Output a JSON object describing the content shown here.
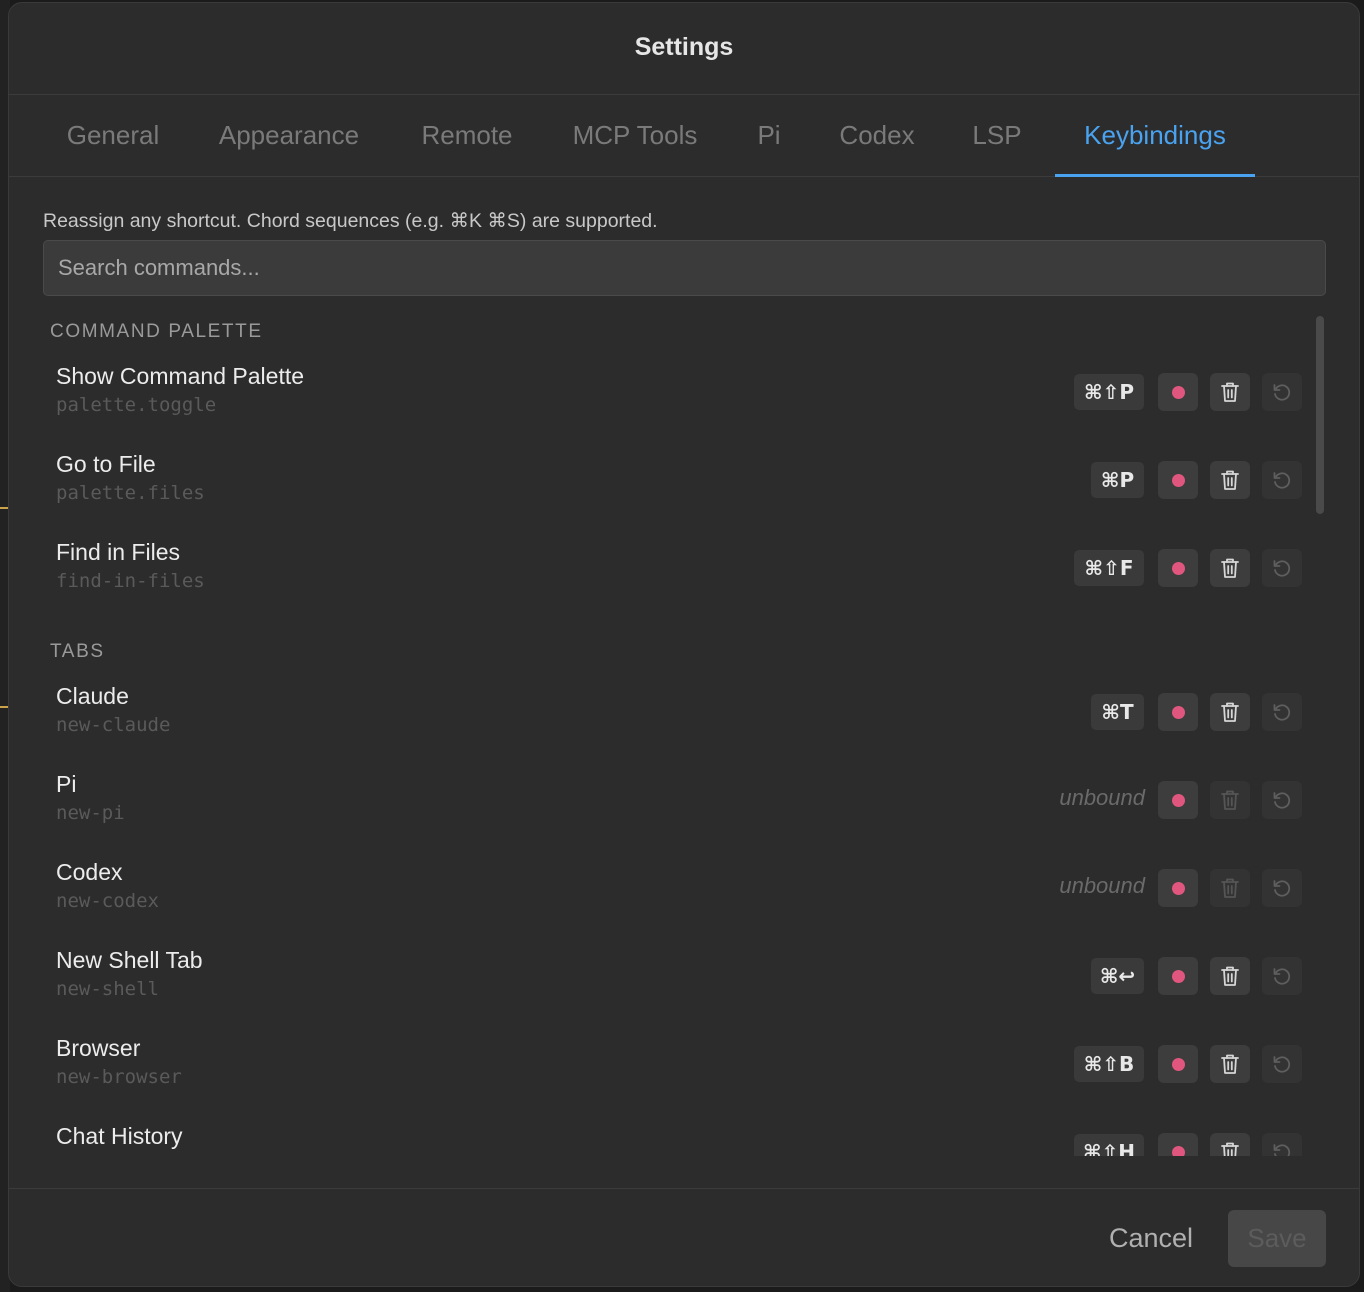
{
  "dialog": {
    "title": "Settings"
  },
  "tabs": [
    {
      "label": "General"
    },
    {
      "label": "Appearance"
    },
    {
      "label": "Remote"
    },
    {
      "label": "MCP Tools"
    },
    {
      "label": "Pi"
    },
    {
      "label": "Codex"
    },
    {
      "label": "LSP"
    },
    {
      "label": "Keybindings",
      "active": true
    }
  ],
  "keybindings": {
    "hint": "Reassign any shortcut. Chord sequences (e.g. ⌘K ⌘S) are supported.",
    "search_placeholder": "Search commands...",
    "sections": [
      {
        "title": "COMMAND PALETTE",
        "commands": [
          {
            "title": "Show Command Palette",
            "id": "palette.toggle",
            "shortcut": "⌘⇧P"
          },
          {
            "title": "Go to File",
            "id": "palette.files",
            "shortcut": "⌘P"
          },
          {
            "title": "Find in Files",
            "id": "find-in-files",
            "shortcut": "⌘⇧F"
          }
        ]
      },
      {
        "title": "TABS",
        "commands": [
          {
            "title": "Claude",
            "id": "new-claude",
            "shortcut": "⌘T"
          },
          {
            "title": "Pi",
            "id": "new-pi",
            "shortcut": "unbound"
          },
          {
            "title": "Codex",
            "id": "new-codex",
            "shortcut": "unbound"
          },
          {
            "title": "New Shell Tab",
            "id": "new-shell",
            "shortcut": "⌘↩"
          },
          {
            "title": "Browser",
            "id": "new-browser",
            "shortcut": "⌘⇧B"
          },
          {
            "title": "Chat History",
            "id": "",
            "shortcut": "⌘⇧H"
          }
        ]
      }
    ]
  },
  "icons": {
    "record": "record-dot-icon",
    "delete": "trash-icon",
    "reset": "reset-icon"
  },
  "colors": {
    "accent": "#4aa3f0",
    "record": "#e0567e"
  },
  "footer": {
    "cancel_label": "Cancel",
    "save_label": "Save"
  }
}
